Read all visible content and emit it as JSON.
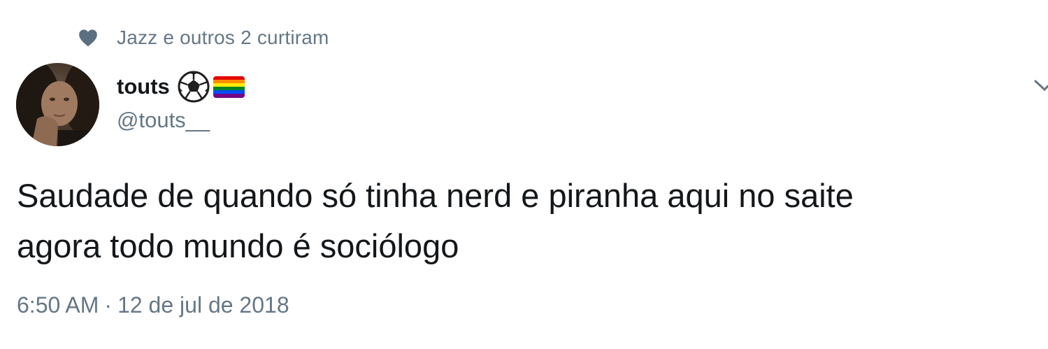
{
  "social_context": {
    "icon": "heart-icon",
    "text": "Jazz e outros 2 curtiram"
  },
  "author": {
    "display_name": "touts",
    "emojis": [
      "soccer-ball",
      "rainbow-flag"
    ],
    "handle": "@touts__"
  },
  "tweet": {
    "lines": [
      "Saudade de quando só tinha nerd e piranha aqui no saite",
      "agora todo mundo é sociólogo"
    ],
    "time": "6:50 AM",
    "separator": "·",
    "date": "12 de jul de 2018"
  },
  "colors": {
    "text_primary": "#14171a",
    "text_secondary": "#657786",
    "heart": "#657786",
    "background": "#ffffff",
    "rainbow": [
      "#e40303",
      "#ff8c00",
      "#ffed00",
      "#008026",
      "#004dff",
      "#750787"
    ]
  }
}
